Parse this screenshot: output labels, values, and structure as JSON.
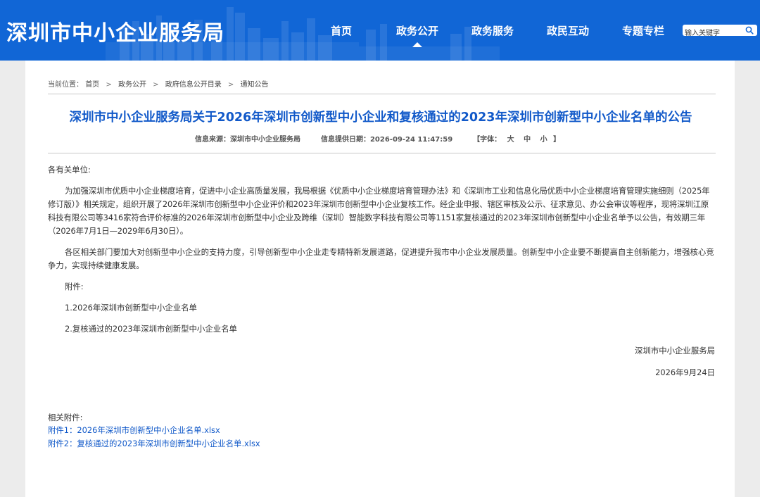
{
  "header": {
    "site_title": "深圳市中小企业服务局",
    "nav": [
      {
        "label": "首页"
      },
      {
        "label": "政务公开"
      },
      {
        "label": "政务服务"
      },
      {
        "label": "政民互动"
      },
      {
        "label": "专题专栏"
      }
    ],
    "active_nav": "政务公开",
    "search": {
      "placeholder": "输入关键字",
      "icon": "search-icon"
    }
  },
  "breadcrumb": {
    "prefix": "当前位置：",
    "items": [
      "首页",
      "政务公开",
      "政府信息公开目录",
      "通知公告"
    ],
    "separator": ">"
  },
  "article": {
    "title": "深圳市中小企业服务局关于2026年深圳市创新型中小企业和复核通过的2023年深圳市创新型中小企业名单的公告",
    "source_label": "信息来源：",
    "source": "深圳市中小企业服务局",
    "date_label": "信息提供日期：",
    "date": "2026-09-24 11:47:59",
    "font_label_open": "【字体：",
    "font_sizes": [
      "大",
      "中",
      "小"
    ],
    "font_label_close": "】",
    "salutation": "各有关单位:",
    "paragraphs": [
      "为加强深圳市优质中小企业梯度培育，促进中小企业高质量发展，我局根据《优质中小企业梯度培育管理办法》和《深圳市工业和信息化局优质中小企业梯度培育管理实施细则（2025年修订版）》相关规定，组织开展了2026年深圳市创新型中小企业评价和2023年深圳市创新型中小企业复核工作。经企业申报、辖区审核及公示、征求意见、办公会审议等程序，现将深圳江原科技有限公司等3416家符合评价标准的2026年深圳市创新型中小企业及跨维（深圳）智能数字科技有限公司等1151家复核通过的2023年深圳市创新型中小企业名单予以公告，有效期三年（2026年7月1日—2029年6月30日）。",
      "各区相关部门要加大对创新型中小企业的支持力度，引导创新型中小企业走专精特新发展道路，促进提升我市中小企业发展质量。创新型中小企业要不断提高自主创新能力，增强核心竞争力，实现持续健康发展。"
    ],
    "attachments_heading": "附件:",
    "attachments_list": [
      "1.2026年深圳市创新型中小企业名单",
      "2.复核通过的2023年深圳市创新型中小企业名单"
    ],
    "signature": "深圳市中小企业服务局",
    "sign_date": "2026年9月24日"
  },
  "related": {
    "label": "相关附件:",
    "links": [
      "附件1：2026年深圳市创新型中小企业名单.xlsx",
      "附件2：复核通过的2023年深圳市创新型中小企业名单.xlsx"
    ]
  },
  "colors": {
    "header_bg": "#1166d6",
    "title_blue": "#1159c9",
    "link_blue": "#1159c9",
    "page_bg": "#ececec"
  }
}
